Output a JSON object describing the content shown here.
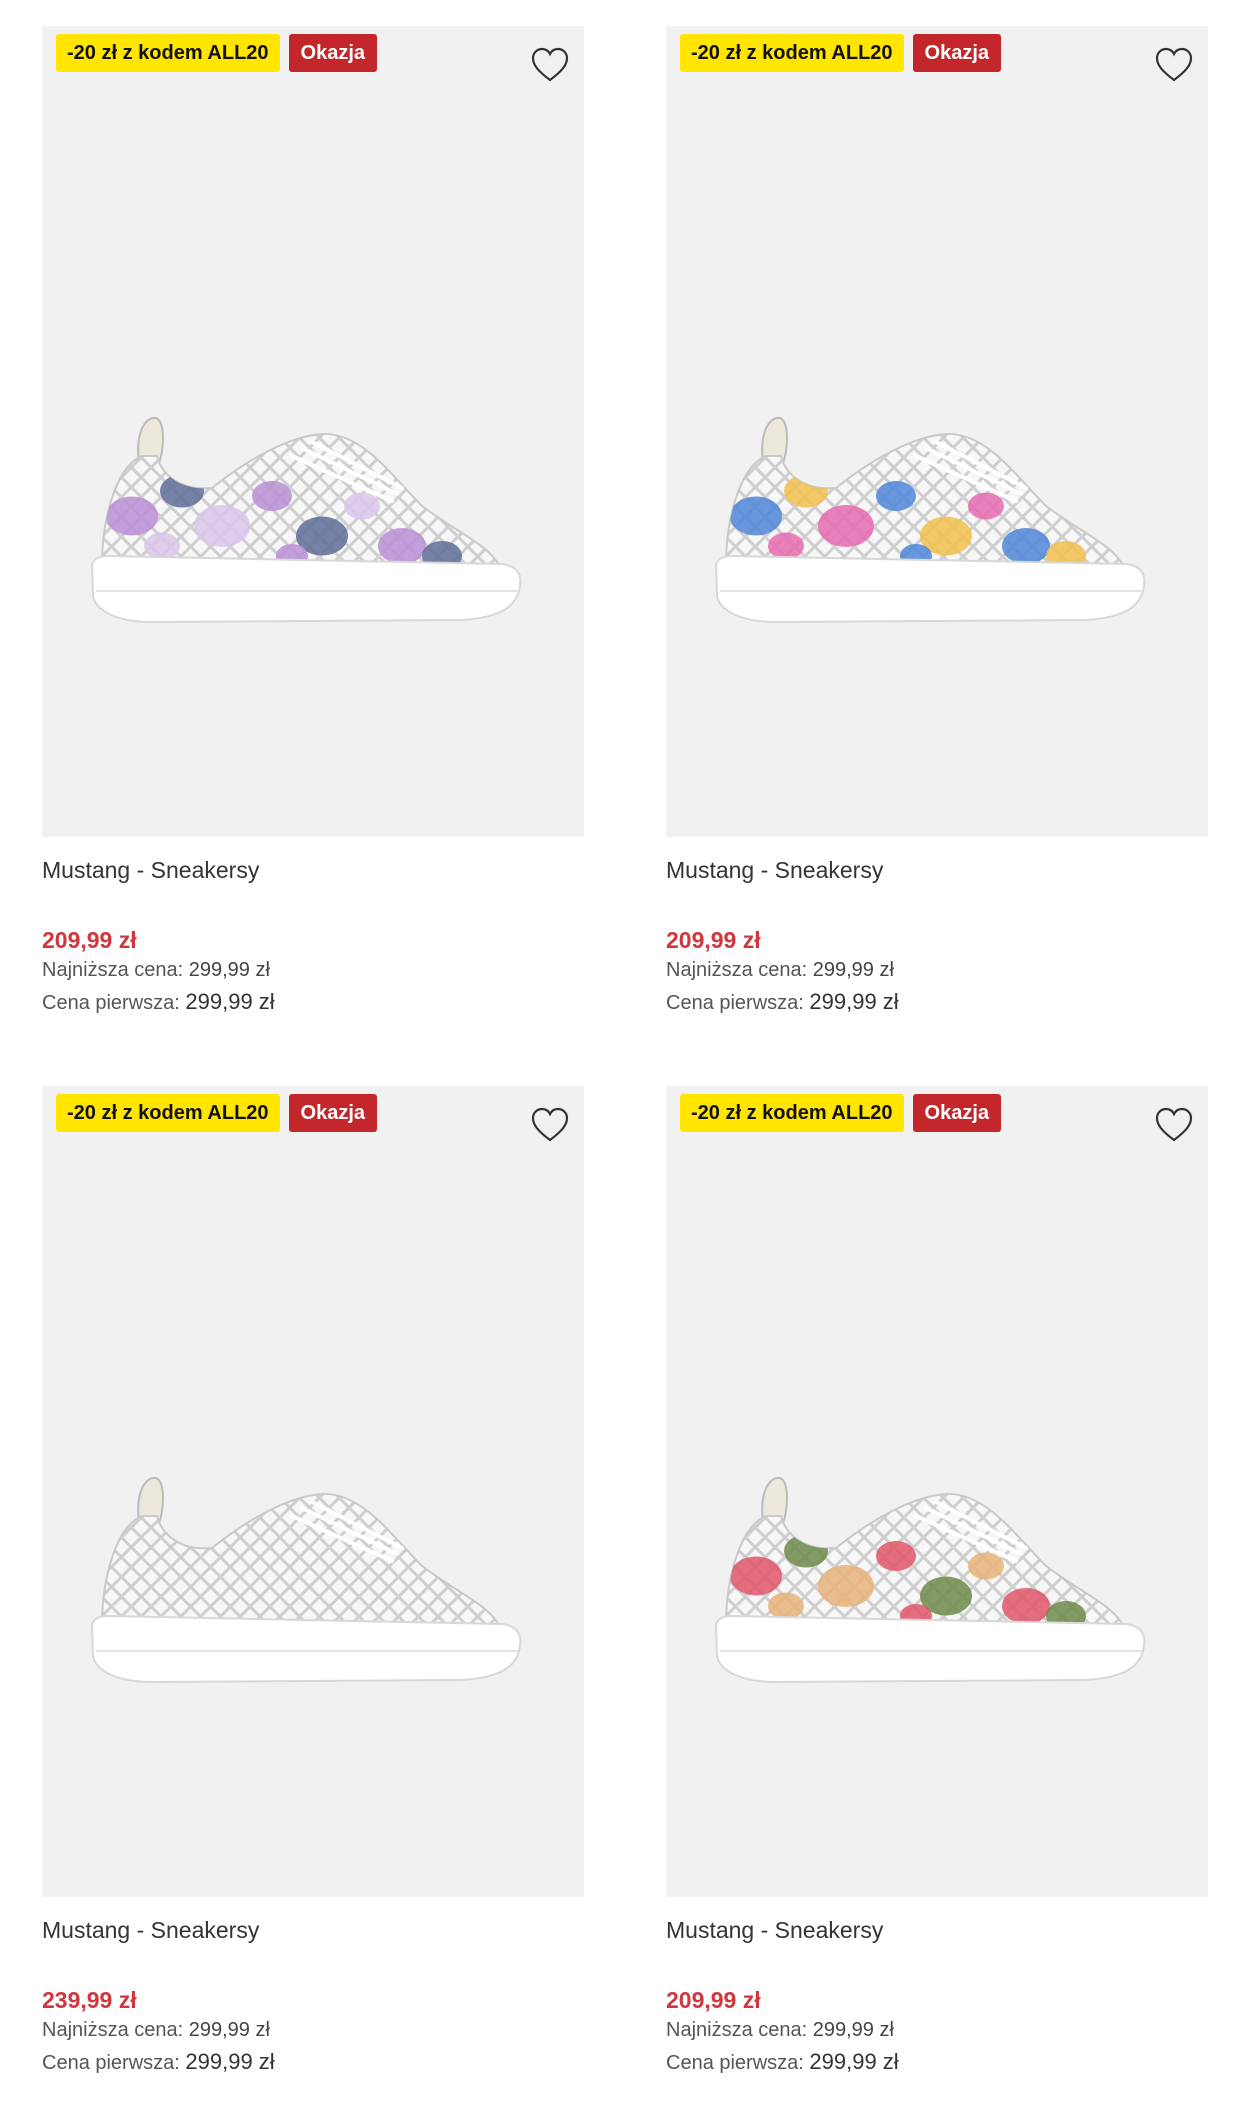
{
  "products": [
    {
      "code_badge": "-20 zł z kodem ALL20",
      "deal_badge": "Okazja",
      "title": "Mustang - Sneakersy",
      "price": "209,99 zł",
      "lowest_label": "Najniższa cena:",
      "lowest_value": "299,99 zł",
      "first_label": "Cena pierwsza:",
      "first_value": "299,99 zł",
      "pattern": "floral-purple",
      "colors": [
        "#b88fd6",
        "#5f6d97",
        "#d9c6ea"
      ]
    },
    {
      "code_badge": "-20 zł z kodem ALL20",
      "deal_badge": "Okazja",
      "title": "Mustang - Sneakersy",
      "price": "209,99 zł",
      "lowest_label": "Najniższa cena:",
      "lowest_value": "299,99 zł",
      "first_label": "Cena pierwsza:",
      "first_value": "299,99 zł",
      "pattern": "rainbow-hearts",
      "colors": [
        "#4f86d9",
        "#f2c14e",
        "#e86bb0"
      ]
    },
    {
      "code_badge": "-20 zł z kodem ALL20",
      "deal_badge": "Okazja",
      "title": "Mustang - Sneakersy",
      "price": "239,99 zł",
      "lowest_label": "Najniższa cena:",
      "lowest_value": "299,99 zł",
      "first_label": "Cena pierwsza:",
      "first_value": "299,99 zł",
      "pattern": "plain-white",
      "colors": [
        "#e8e8e8",
        "#d9d9d9",
        "#f4f4f4"
      ]
    },
    {
      "code_badge": "-20 zł z kodem ALL20",
      "deal_badge": "Okazja",
      "title": "Mustang - Sneakersy",
      "price": "209,99 zł",
      "lowest_label": "Najniższa cena:",
      "lowest_value": "299,99 zł",
      "first_label": "Cena pierwsza:",
      "first_value": "299,99 zł",
      "pattern": "floral-red",
      "colors": [
        "#e0566b",
        "#6d8a4a",
        "#e8b37a"
      ]
    }
  ],
  "icons": {
    "favorite": "heart-outline-icon"
  },
  "theme": {
    "sale_price": "#d0363d",
    "code_badge_bg": "#ffe500",
    "deal_badge_bg": "#c3272b",
    "image_bg": "#f1f1f1"
  }
}
